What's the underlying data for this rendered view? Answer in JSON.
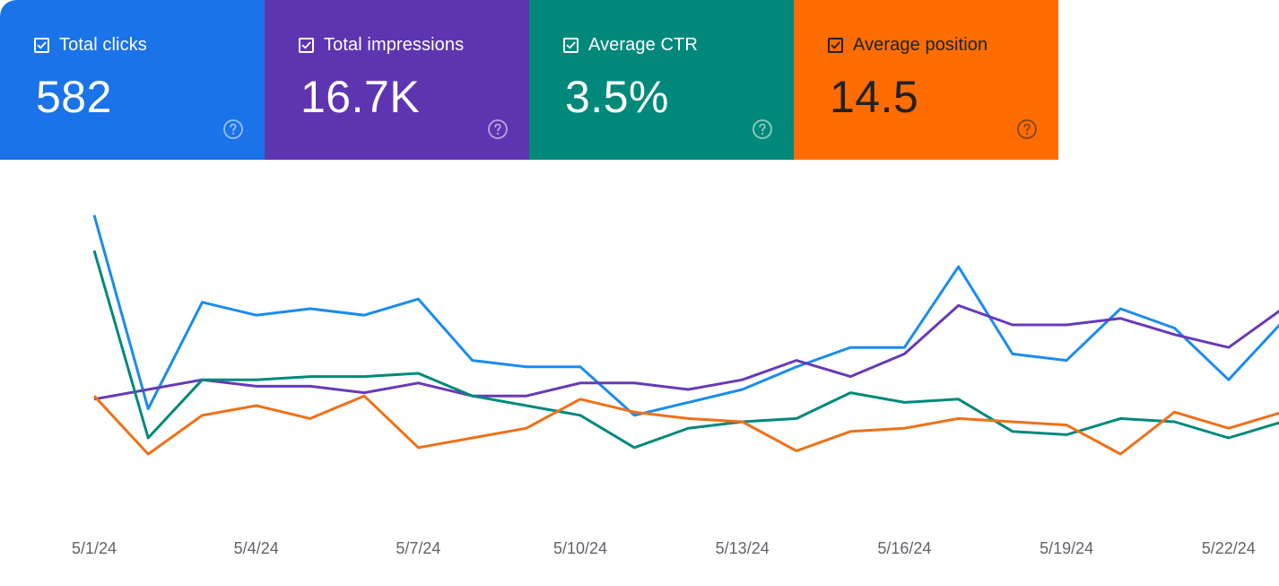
{
  "metrics": [
    {
      "label": "Total clicks",
      "value": "582",
      "bg": "#1a73e8",
      "fg": "#ffffff",
      "checked": true,
      "help_icon": "help-circle-icon"
    },
    {
      "label": "Total impressions",
      "value": "16.7K",
      "bg": "#5e35b1",
      "fg": "#ffffff",
      "checked": true,
      "help_icon": "help-circle-icon"
    },
    {
      "label": "Average CTR",
      "value": "3.5%",
      "bg": "#00897b",
      "fg": "#ffffff",
      "checked": true,
      "help_icon": "help-circle-icon"
    },
    {
      "label": "Average position",
      "value": "14.5",
      "bg": "#ff6d00",
      "fg": "#202124",
      "checked": true,
      "help_icon": "help-circle-icon"
    }
  ],
  "chart_data": {
    "type": "line",
    "x": [
      "5/1/24",
      "5/2/24",
      "5/3/24",
      "5/4/24",
      "5/5/24",
      "5/6/24",
      "5/7/24",
      "5/8/24",
      "5/9/24",
      "5/10/24",
      "5/11/24",
      "5/12/24",
      "5/13/24",
      "5/14/24",
      "5/15/24",
      "5/16/24",
      "5/17/24",
      "5/18/24",
      "5/19/24",
      "5/20/24",
      "5/21/24",
      "5/22/24",
      "5/23/24"
    ],
    "x_tick_labels": [
      "5/1/24",
      "5/4/24",
      "5/7/24",
      "5/10/24",
      "5/13/24",
      "5/16/24",
      "5/19/24",
      "5/22/24"
    ],
    "yaxis_shown": false,
    "grid": false,
    "series": [
      {
        "name": "Total clicks",
        "color": "#1a8cf0",
        "values": [
          0.94,
          0.34,
          0.67,
          0.63,
          0.65,
          0.63,
          0.68,
          0.49,
          0.47,
          0.47,
          0.32,
          0.36,
          0.4,
          0.47,
          0.53,
          0.53,
          0.78,
          0.51,
          0.49,
          0.65,
          0.59,
          0.43,
          0.61
        ]
      },
      {
        "name": "Total impressions",
        "color": "#673ab7",
        "values": [
          0.37,
          0.4,
          0.43,
          0.41,
          0.41,
          0.39,
          0.42,
          0.38,
          0.38,
          0.42,
          0.42,
          0.4,
          0.43,
          0.49,
          0.44,
          0.51,
          0.66,
          0.6,
          0.6,
          0.62,
          0.57,
          0.53,
          0.65
        ]
      },
      {
        "name": "Average CTR",
        "color": "#00897b",
        "values": [
          0.83,
          0.25,
          0.43,
          0.43,
          0.44,
          0.44,
          0.45,
          0.38,
          0.35,
          0.32,
          0.22,
          0.28,
          0.3,
          0.31,
          0.39,
          0.36,
          0.37,
          0.27,
          0.26,
          0.31,
          0.3,
          0.25,
          0.3
        ]
      },
      {
        "name": "Average position",
        "color": "#f07018",
        "values": [
          0.38,
          0.2,
          0.32,
          0.35,
          0.31,
          0.38,
          0.22,
          0.25,
          0.28,
          0.37,
          0.33,
          0.31,
          0.3,
          0.21,
          0.27,
          0.28,
          0.31,
          0.3,
          0.29,
          0.2,
          0.33,
          0.28,
          0.33
        ]
      }
    ]
  }
}
